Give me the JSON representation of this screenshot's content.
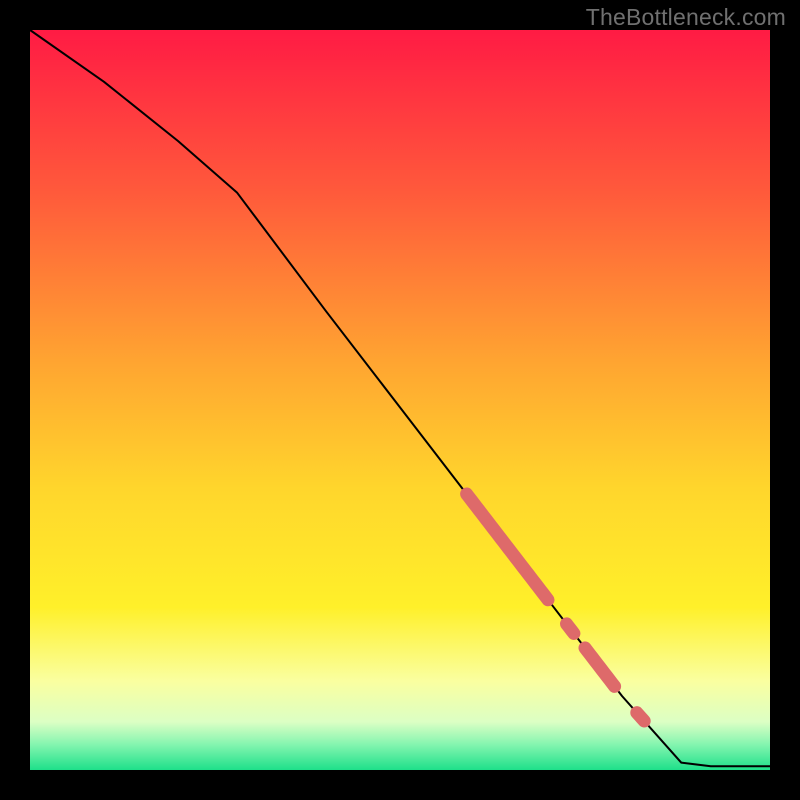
{
  "watermark": "TheBottleneck.com",
  "colors": {
    "line": "#000000",
    "marker": "#de6a6a",
    "gradient_stops": [
      {
        "pos": 0,
        "color": "#ff1b44"
      },
      {
        "pos": 0.22,
        "color": "#ff5a3b"
      },
      {
        "pos": 0.45,
        "color": "#ffa531"
      },
      {
        "pos": 0.62,
        "color": "#ffd62c"
      },
      {
        "pos": 0.78,
        "color": "#fff02a"
      },
      {
        "pos": 0.88,
        "color": "#faffa0"
      },
      {
        "pos": 0.935,
        "color": "#dcffc4"
      },
      {
        "pos": 0.965,
        "color": "#86f5b0"
      },
      {
        "pos": 1.0,
        "color": "#1ee08a"
      }
    ]
  },
  "chart_data": {
    "type": "line",
    "title": "",
    "xlabel": "",
    "ylabel": "",
    "xlim": [
      0,
      100
    ],
    "ylim": [
      0,
      100
    ],
    "note": "Axes are unlabeled in the source image; x/y treated as 0–100 percent of plot area (x left→right, y bottom→top). Line y-values are percentage heights read from the chart.",
    "series": [
      {
        "name": "curve",
        "x": [
          0,
          10,
          20,
          28,
          40,
          50,
          60,
          70,
          80,
          88,
          92,
          100
        ],
        "y": [
          100,
          93,
          85,
          78,
          62,
          49,
          36,
          23,
          10,
          1,
          0.5,
          0.5
        ]
      }
    ],
    "markers": {
      "name": "highlight-segments",
      "style": "thick rounded strokes on the curve",
      "segments_x": [
        [
          59,
          70
        ],
        [
          72.5,
          73.5
        ],
        [
          75,
          79
        ],
        [
          82,
          83
        ]
      ]
    }
  }
}
